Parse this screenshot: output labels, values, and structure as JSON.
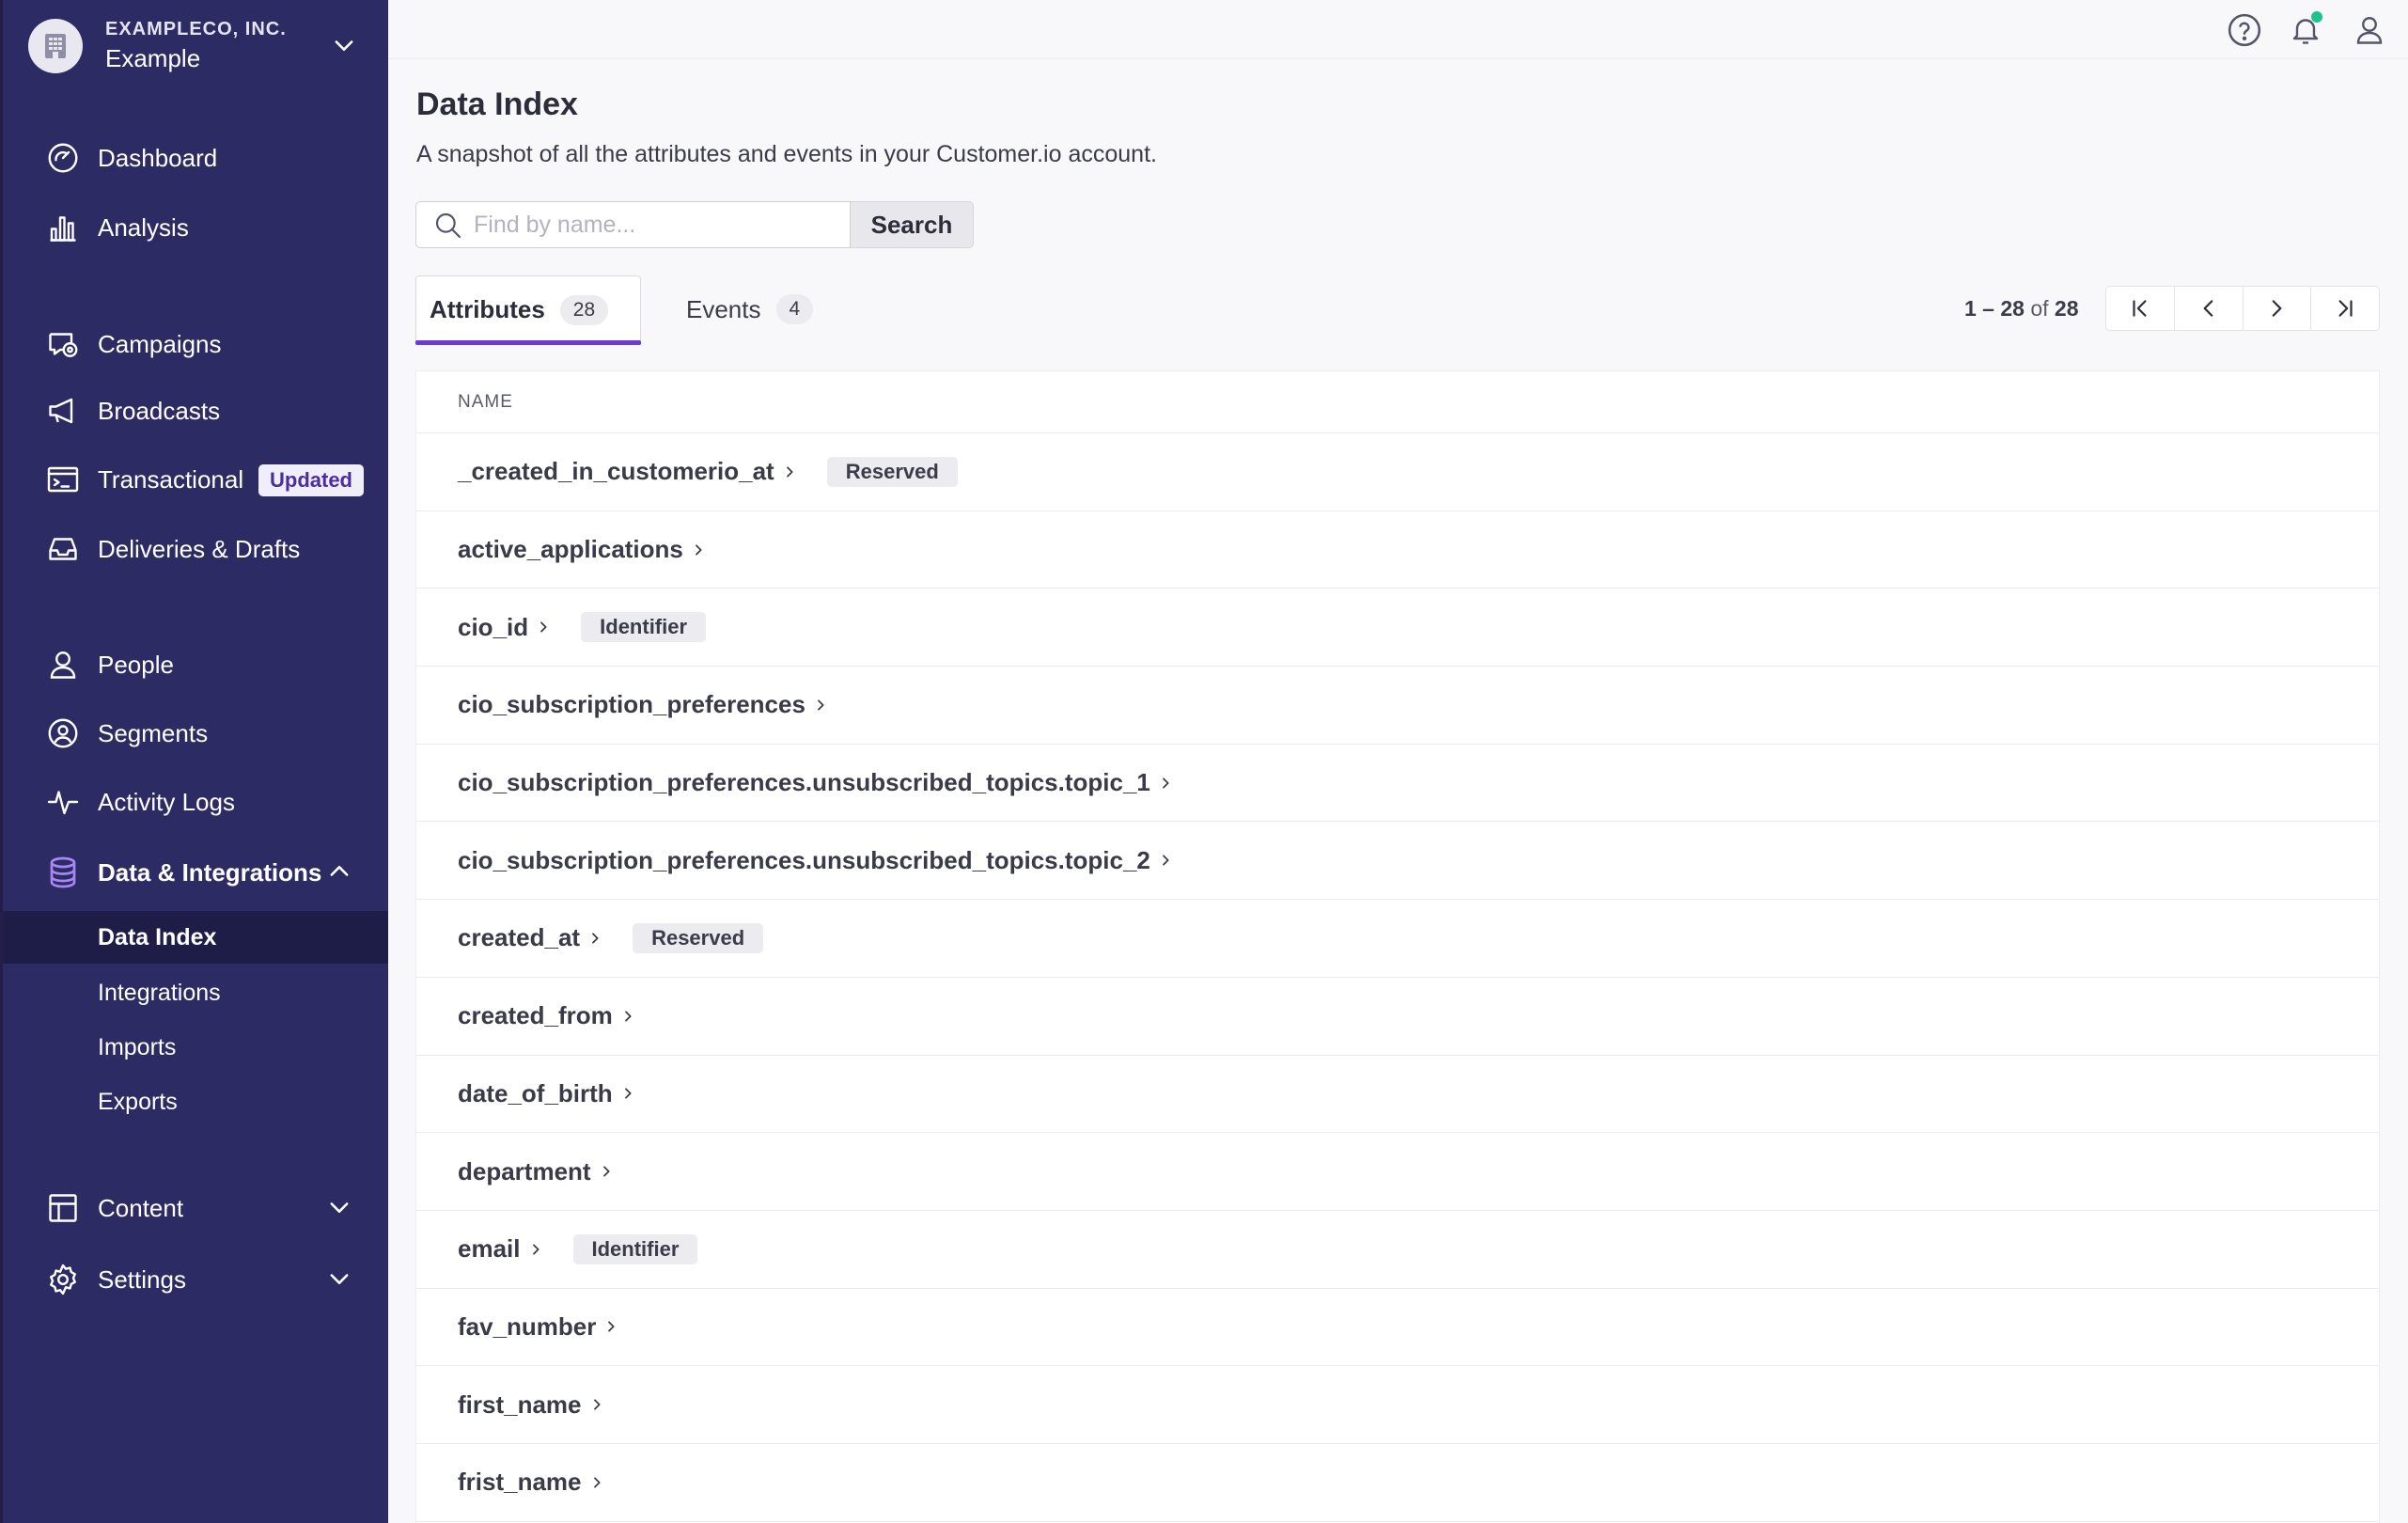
{
  "workspace": {
    "company": "EXAMPLECO, INC.",
    "name": "Example"
  },
  "sidebar": {
    "items": [
      {
        "label": "Dashboard"
      },
      {
        "label": "Analysis"
      },
      {
        "label": "Campaigns"
      },
      {
        "label": "Broadcasts"
      },
      {
        "label": "Transactional",
        "badge": "Updated"
      },
      {
        "label": "Deliveries & Drafts"
      },
      {
        "label": "People"
      },
      {
        "label": "Segments"
      },
      {
        "label": "Activity Logs"
      },
      {
        "label": "Data & Integrations"
      },
      {
        "label": "Content"
      },
      {
        "label": "Settings"
      }
    ],
    "sub_items": [
      {
        "label": "Data Index",
        "active": true
      },
      {
        "label": "Integrations"
      },
      {
        "label": "Imports"
      },
      {
        "label": "Exports"
      }
    ]
  },
  "header": {
    "title": "Data Index",
    "subtitle": "A snapshot of all the attributes and events in your Customer.io account."
  },
  "search": {
    "placeholder": "Find by name...",
    "value": "",
    "button": "Search"
  },
  "tabs": [
    {
      "label": "Attributes",
      "count": "28",
      "active": true
    },
    {
      "label": "Events",
      "count": "4"
    }
  ],
  "pagination": {
    "range": "1 – 28",
    "of": "of",
    "total": "28"
  },
  "table": {
    "header": "NAME",
    "rows": [
      {
        "name": "_created_in_customerio_at",
        "badge": "Reserved"
      },
      {
        "name": "active_applications",
        "badge": ""
      },
      {
        "name": "cio_id",
        "badge": "Identifier"
      },
      {
        "name": "cio_subscription_preferences",
        "badge": ""
      },
      {
        "name": "cio_subscription_preferences.unsubscribed_topics.topic_1",
        "badge": ""
      },
      {
        "name": "cio_subscription_preferences.unsubscribed_topics.topic_2",
        "badge": ""
      },
      {
        "name": "created_at",
        "badge": "Reserved"
      },
      {
        "name": "created_from",
        "badge": ""
      },
      {
        "name": "date_of_birth",
        "badge": ""
      },
      {
        "name": "department",
        "badge": ""
      },
      {
        "name": "email",
        "badge": "Identifier"
      },
      {
        "name": "fav_number",
        "badge": ""
      },
      {
        "name": "first_name",
        "badge": ""
      },
      {
        "name": "frist_name",
        "badge": ""
      }
    ]
  },
  "colors": {
    "sidebar": "#2d2b63",
    "accent": "#6a3ad6",
    "notification": "#1ec28b"
  }
}
